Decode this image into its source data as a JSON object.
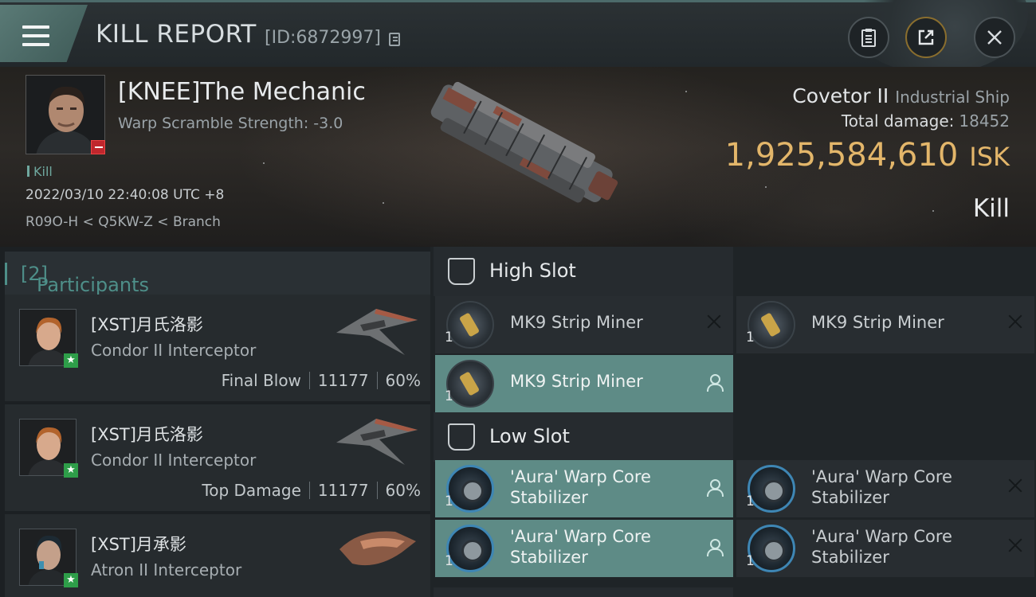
{
  "header": {
    "title": "KILL REPORT",
    "id_label": "[ID:6872997]",
    "buttons": [
      "clipboard-icon",
      "share-icon",
      "close-icon"
    ]
  },
  "victim": {
    "name": "[KNEE]The Mechanic",
    "warp": "Warp Scramble Strength: -3.0",
    "kill_tag": "Kill",
    "datetime": "2022/03/10 22:40:08 UTC +8",
    "location": "R09O-H < Q5KW-Z < Branch",
    "ship": "Covetor II",
    "ship_class": "Industrial Ship",
    "total_damage_label": "Total damage:",
    "total_damage": "18452",
    "isk_value": "1,925,584,610",
    "isk_unit": "ISK",
    "result": "Kill"
  },
  "participants": {
    "title": "Participants",
    "count": "[2]",
    "rows": [
      {
        "name": "[XST]月氏洛影",
        "ship": "Condor II Interceptor",
        "role": "Final Blow",
        "damage": "11177",
        "percent": "60%"
      },
      {
        "name": "[XST]月氏洛影",
        "ship": "Condor II Interceptor",
        "role": "Top Damage",
        "damage": "11177",
        "percent": "60%"
      },
      {
        "name": "[XST]月承影",
        "ship": "Atron II Interceptor"
      }
    ]
  },
  "fitting": {
    "high_slot": {
      "title": "High Slot",
      "modules": [
        {
          "qty": "1",
          "name": "MK9 Strip Miner"
        },
        {
          "qty": "1",
          "name": "MK9 Strip Miner"
        },
        {
          "qty": "1",
          "name": "MK9 Strip Miner"
        }
      ]
    },
    "low_slot": {
      "title": "Low Slot",
      "modules": [
        {
          "qty": "1",
          "name": "'Aura' Warp Core Stabilizer"
        },
        {
          "qty": "1",
          "name": "'Aura' Warp Core Stabilizer"
        },
        {
          "qty": "1",
          "name": "'Aura' Warp Core Stabilizer"
        },
        {
          "qty": "1",
          "name": "'Aura' Warp Core Stabilizer"
        }
      ]
    }
  },
  "colors": {
    "accent": "#5e8b86",
    "isk": "#e3b66a",
    "participants_title": "#4e8f89",
    "kill_badge": "#c0272d",
    "star_badge": "#2e9e49"
  }
}
